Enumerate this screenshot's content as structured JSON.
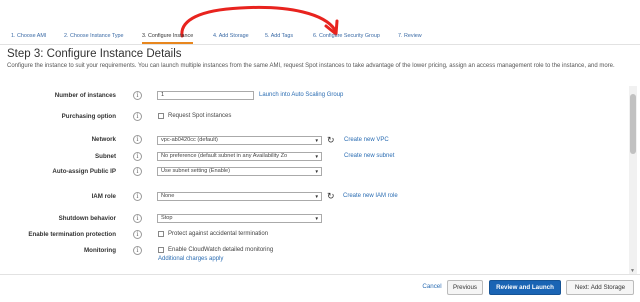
{
  "wizard": {
    "steps": [
      "1. Choose AMI",
      "2. Choose Instance Type",
      "3. Configure Instance",
      "4. Add Storage",
      "5. Add Tags",
      "6. Configure Security Group",
      "7. Review"
    ],
    "current_step": "3. Configure Instance"
  },
  "page": {
    "title": "Step 3: Configure Instance Details",
    "description": "Configure the instance to suit your requirements. You can launch multiple instances from the same AMI, request Spot instances to take advantage of the lower pricing, assign an access management role to the instance, and more."
  },
  "form": {
    "number_of_instances": {
      "label": "Number of instances",
      "value": "1",
      "link": "Launch into Auto Scaling Group"
    },
    "purchasing_option": {
      "label": "Purchasing option",
      "checkbox_label": "Request Spot instances",
      "checked": false
    },
    "network": {
      "label": "Network",
      "value": "vpc-ab0420cc (default)",
      "link": "Create new VPC"
    },
    "subnet": {
      "label": "Subnet",
      "value": "No preference (default subnet in any Availability Zo",
      "link": "Create new subnet"
    },
    "auto_assign_ip": {
      "label": "Auto-assign Public IP",
      "value": "Use subnet setting (Enable)"
    },
    "iam_role": {
      "label": "IAM role",
      "value": "None",
      "link": "Create new IAM role"
    },
    "shutdown_behavior": {
      "label": "Shutdown behavior",
      "value": "Stop"
    },
    "termination_protection": {
      "label": "Enable termination protection",
      "checkbox_label": "Protect against accidental termination",
      "checked": false
    },
    "monitoring": {
      "label": "Monitoring",
      "checkbox_label": "Enable CloudWatch detailed monitoring",
      "checked": false,
      "note": "Additional charges apply"
    }
  },
  "footer": {
    "cancel": "Cancel",
    "previous": "Previous",
    "review_and_launch": "Review and Launch",
    "next": "Next: Add Storage"
  },
  "colors": {
    "accent_link": "#2b6db3",
    "primary_button": "#1a64b4",
    "current_step_underline": "#e8871e",
    "annotation_stroke": "#e8231e"
  }
}
